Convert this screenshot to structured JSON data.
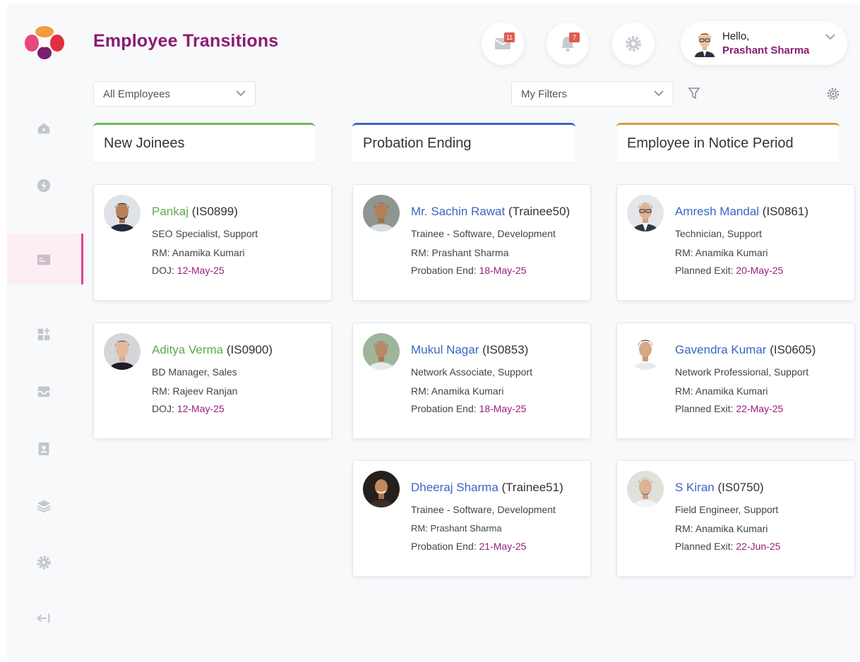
{
  "header": {
    "title": "Employee Transitions",
    "mail_count": "11",
    "notification_count": "7",
    "user": {
      "hello": "Hello,",
      "name": "Prashant Sharma"
    }
  },
  "filters": {
    "employees_select": "All Employees",
    "my_filters_select": "My Filters"
  },
  "sidebar": {
    "items": [
      "home-icon",
      "bolt-icon",
      "id-card-icon",
      "dashboard-icon",
      "inbox-icon",
      "contacts-icon",
      "layers-icon",
      "settings-icon",
      "collapse-icon"
    ],
    "active_color": "#e0408a"
  },
  "columns": [
    {
      "title": "New Joinees",
      "accent": "#6bb85c",
      "cards": [
        {
          "name": "Pankaj",
          "code": "(IS0899)",
          "role": "SEO Specialist, Support",
          "rm": "RM: Anamika Kumari",
          "date_label": "DOJ: ",
          "date": "12-May-25"
        },
        {
          "name": "Aditya Verma",
          "code": "(IS0900)",
          "role": "BD Manager, Sales",
          "rm": "RM: Rajeev Ranjan",
          "date_label": "DOJ: ",
          "date": "12-May-25"
        }
      ]
    },
    {
      "title": "Probation Ending",
      "accent": "#3a66c4",
      "cards": [
        {
          "name": "Mr. Sachin Rawat",
          "code": "(Trainee50)",
          "role": "Trainee - Software, Development",
          "rm": "RM: Prashant Sharma",
          "date_label": "Probation End: ",
          "date": "18-May-25"
        },
        {
          "name": "Mukul Nagar",
          "code": "(IS0853)",
          "role": "Network Associate, Support",
          "rm": "RM: Anamika Kumari",
          "date_label": "Probation End: ",
          "date": "18-May-25"
        },
        {
          "name": "Dheeraj Sharma",
          "code": "(Trainee51)",
          "role": "Trainee - Software, Development",
          "rm": "RM: Prashant Sharma",
          "date_label": "Probation End: ",
          "date": "21-May-25"
        }
      ]
    },
    {
      "title": "Employee in Notice Period",
      "accent": "#d1a23a",
      "cards": [
        {
          "name": "Amresh Mandal",
          "code": "(IS0861)",
          "role": "Technician, Support",
          "rm": "RM: Anamika Kumari",
          "date_label": "Planned Exit: ",
          "date": "20-May-25"
        },
        {
          "name": "Gavendra Kumar",
          "code": "(IS0605)",
          "role": "Network Professional, Support",
          "rm": "RM: Anamika Kumari",
          "date_label": "Planned Exit: ",
          "date": "22-May-25"
        },
        {
          "name": "S Kiran",
          "code": "(IS0750)",
          "role": "Field Engineer, Support",
          "rm": "RM: Anamika Kumari",
          "date_label": "Planned Exit: ",
          "date": "22-Jun-25"
        }
      ]
    }
  ]
}
